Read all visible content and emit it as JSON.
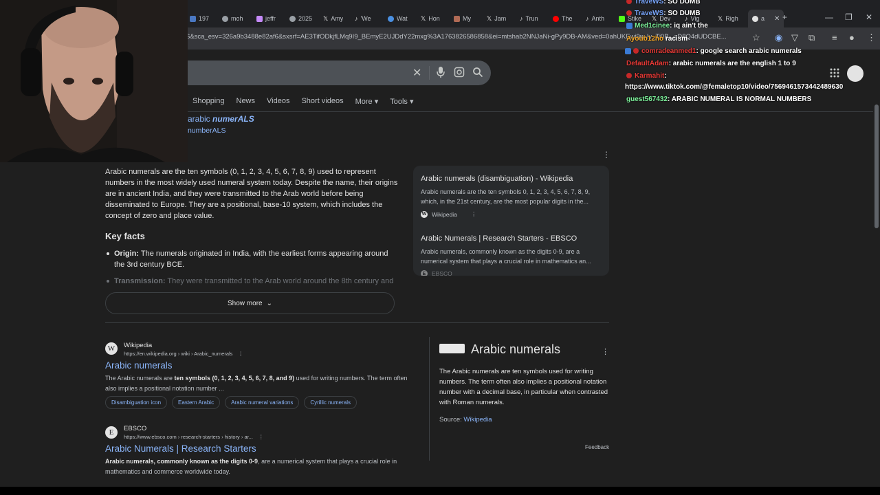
{
  "tabs": [
    {
      "label": "197",
      "color": "#4a78c2"
    },
    {
      "label": "moh",
      "color": "#9aa0a6"
    },
    {
      "label": "jeffr",
      "color": "#c58af9"
    },
    {
      "label": "2025",
      "color": "#9aa0a6"
    },
    {
      "label": "Amy",
      "color": "#e3e3e3"
    },
    {
      "label": "'We",
      "color": "#e3e3e3"
    },
    {
      "label": "Wat",
      "color": "#4a90e2"
    },
    {
      "label": "Hon",
      "color": "#e3e3e3"
    },
    {
      "label": "My",
      "color": "#b06a55"
    },
    {
      "label": "Jam",
      "color": "#e3e3e3"
    },
    {
      "label": "Trun",
      "color": "#e3e3e3"
    },
    {
      "label": "The",
      "color": "#ff0000"
    },
    {
      "label": "Anth",
      "color": "#e3e3e3"
    },
    {
      "label": "Stike",
      "color": "#53fc18"
    },
    {
      "label": "Dev",
      "color": "#e3e3e3"
    },
    {
      "label": "Vig",
      "color": "#e3e3e3"
    },
    {
      "label": "Righ",
      "color": "#e3e3e3"
    }
  ],
  "active_tab_label": "a",
  "url": "S&sca_esv=326a9b3488e82af6&sxsrf=AE3TifODkjfLMq9I9_BEmyE2UJDdY22mxg%3A1763826586858&ei=mtshab2NNJaNi-gPy9DB-AM&ved=0ahUKEwi9w-Iy_Ti0B...zD8Q4dUDCBE...",
  "search": {
    "query": "",
    "clear_icon": "✕"
  },
  "filters": [
    "Shopping",
    "News",
    "Videos",
    "Short videos",
    "More ▾",
    "Tools ▾"
  ],
  "did_you_mean": {
    "prefix": "arabic ",
    "corrected": "numerALS",
    "second": "numberALS"
  },
  "overview": {
    "text": "Arabic numerals are the ten symbols (0, 1, 2, 3, 4, 5, 6, 7, 8, 9) used to represent numbers in the most widely used numeral system today. Despite the name, their origins are in ancient India, and they were transmitted to the Arab world before being disseminated to Europe. They are a positional, base-10 system, which includes the concept of zero and place value.",
    "key_facts_heading": "Key facts",
    "fact1_label": "Origin:",
    "fact1_text": " The numerals originated in India, with the earliest forms appearing around the 3rd century BCE.",
    "fact2_label": "Transmission:",
    "fact2_text": " They were transmitted to the Arab world around the 8th century and",
    "show_more": "Show more"
  },
  "sources": [
    {
      "title": "Arabic numerals (disambiguation) - Wikipedia",
      "desc": "Arabic numerals are the ten symbols 0, 1, 2, 3, 4, 5, 6, 7, 8, 9, which, in the 21st century, are the most popular digits in the...",
      "site": "Wikipedia",
      "logo": "W"
    },
    {
      "title": "Arabic Numerals | Research Starters - EBSCO",
      "desc": "Arabic numerals, commonly known as the digits 0-9, are a numerical system that plays a crucial role in mathematics an...",
      "site": "EBSCO",
      "logo": "E"
    }
  ],
  "results": [
    {
      "site": "Wikipedia",
      "url": "https://en.wikipedia.org › wiki › Arabic_numerals",
      "title": "Arabic numerals",
      "snippet_pre": "The Arabic numerals are ",
      "snippet_bold": "ten symbols (0, 1, 2, 3, 4, 5, 6, 7, 8, and 9)",
      "snippet_post": " used for writing numbers. The term often also implies a positional notation number ...",
      "logo": "W"
    },
    {
      "site": "EBSCO",
      "url": "https://www.ebsco.com › research-starters › history › ar...",
      "title": "Arabic Numerals | Research Starters",
      "snippet_pre": "",
      "snippet_bold": "Arabic numerals, commonly known as the digits 0-9",
      "snippet_post": ", are a numerical system that plays a crucial role in mathematics and commerce worldwide today.",
      "logo": "E"
    }
  ],
  "chips": [
    "Disambiguation icon",
    "Eastern Arabic",
    "Arabic numeral variations",
    "Cyrillic numerals"
  ],
  "knowledge_panel": {
    "title": "Arabic numerals",
    "desc": "The Arabic numerals are ten symbols used for writing numbers. The term often also implies a positional notation number with a decimal base, in particular when contrasted with Roman numerals.",
    "source_label": "Source: ",
    "source_link": "Wikipedia",
    "feedback": "Feedback"
  },
  "chat": [
    {
      "user": "TraveWS",
      "msg": ": SO DUMB",
      "color": "#7aa7ff"
    },
    {
      "user": "TraveWS",
      "msg": ": SO DUMB",
      "color": "#7aa7ff"
    },
    {
      "user": "Med1cinee",
      "msg": ": iq ain't the",
      "color": "#7cf29a"
    },
    {
      "user": "Ayoub12ho",
      "msg": "racism",
      "color": "#f5a623"
    },
    {
      "user": "comradeanmed1",
      "msg": ": google search arabic numerals",
      "color": "#e53935"
    },
    {
      "user": "DefaultAdam",
      "msg": ": arabic numerals are the english 1 to 9",
      "color": "#e53935"
    },
    {
      "user": "Karmahit",
      "msg": ":",
      "color": "#e53935"
    },
    {
      "user": "",
      "msg": "https://www.tiktok.com/@femaletop10/video/7569461573442489630",
      "color": "#ffffff"
    },
    {
      "user": "guest567432",
      "msg": ": ARABIC NUMERAL IS NORMAL NUMBERS",
      "color": "#7cf29a"
    }
  ]
}
